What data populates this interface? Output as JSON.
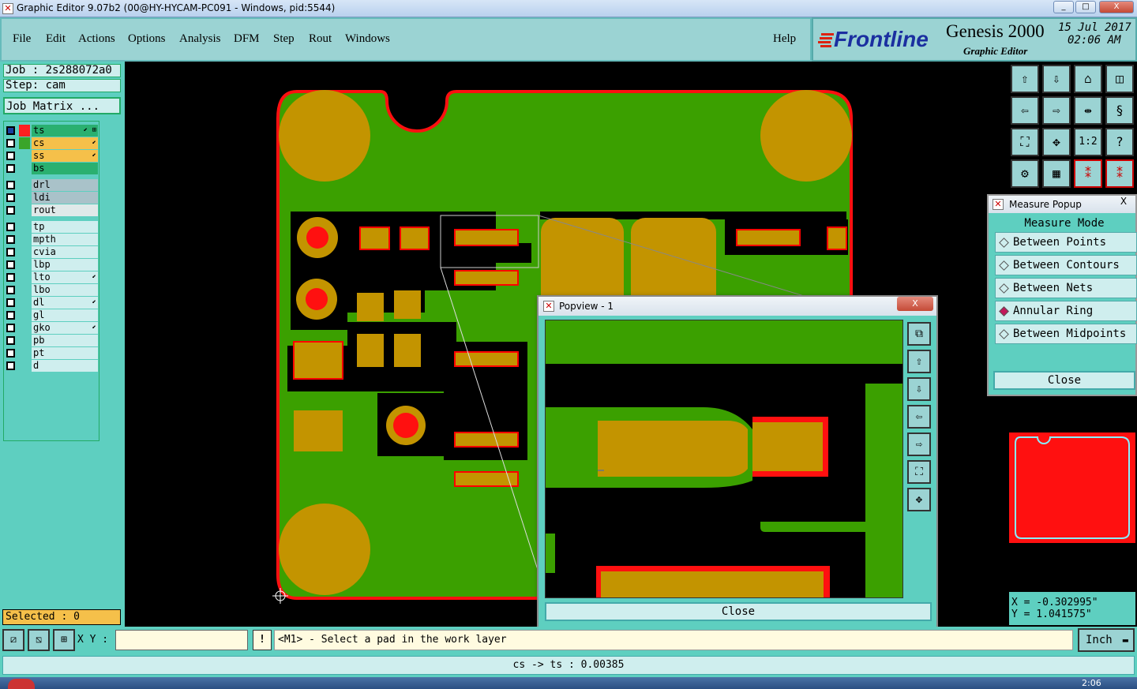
{
  "window": {
    "title": "Graphic Editor 9.07b2 (00@HY-HYCAM-PC091 - Windows, pid:5544)",
    "min": "_",
    "max": "□",
    "close": "X"
  },
  "menu": {
    "items": [
      "File",
      "Edit",
      "Actions",
      "Options",
      "Analysis",
      "DFM",
      "Step",
      "Rout",
      "Windows"
    ],
    "help": "Help"
  },
  "brand": {
    "logo": "Frontline",
    "product": "Genesis 2000",
    "subtitle": "Graphic Editor",
    "date": "15 Jul 2017",
    "time": "02:06 AM"
  },
  "job": {
    "job_label": "Job : 2s288072a0",
    "step_label": "Step: cam",
    "matrix_button": "Job Matrix ...",
    "selected": "Selected : 0"
  },
  "layers": [
    {
      "name": "ts",
      "color": "#2ab070",
      "swatch": "#ff2020",
      "mark": "⬋ ⊞"
    },
    {
      "name": "cs",
      "color": "#f5c04a",
      "swatch": "#3aa52a",
      "mark": "⬋"
    },
    {
      "name": "ss",
      "color": "#f5c04a",
      "swatch": "",
      "mark": "⬋"
    },
    {
      "name": "bs",
      "color": "#2ab070",
      "swatch": "",
      "mark": ""
    },
    {
      "name": "drl",
      "color": "#a9c2c9",
      "swatch": "",
      "mark": ""
    },
    {
      "name": "ldi",
      "color": "#a9c2c9",
      "swatch": "",
      "mark": ""
    },
    {
      "name": "rout",
      "color": "#dfe9e9",
      "swatch": "",
      "mark": ""
    },
    {
      "name": "tp",
      "color": "#cfeeee",
      "swatch": "",
      "mark": ""
    },
    {
      "name": "mpth",
      "color": "#cfeeee",
      "swatch": "",
      "mark": ""
    },
    {
      "name": "cvia",
      "color": "#cfeeee",
      "swatch": "",
      "mark": ""
    },
    {
      "name": "lbp",
      "color": "#cfeeee",
      "swatch": "",
      "mark": ""
    },
    {
      "name": "lto",
      "color": "#cfeeee",
      "swatch": "",
      "mark": "⬋"
    },
    {
      "name": "lbo",
      "color": "#cfeeee",
      "swatch": "",
      "mark": ""
    },
    {
      "name": "dl",
      "color": "#cfeeee",
      "swatch": "",
      "mark": "⬋"
    },
    {
      "name": "gl",
      "color": "#cfeeee",
      "swatch": "",
      "mark": ""
    },
    {
      "name": "gko",
      "color": "#cfeeee",
      "swatch": "",
      "mark": "⬋"
    },
    {
      "name": "pb",
      "color": "#cfeeee",
      "swatch": "",
      "mark": ""
    },
    {
      "name": "pt",
      "color": "#cfeeee",
      "swatch": "",
      "mark": ""
    },
    {
      "name": "d",
      "color": "#cfeeee",
      "swatch": "",
      "mark": ""
    }
  ],
  "measure": {
    "title": "Measure Popup",
    "close_x": "X",
    "mode_label": "Measure Mode",
    "options": [
      "Between Points",
      "Between Contours",
      "Between Nets",
      "Annular Ring",
      "Between Midpoints"
    ],
    "selected": "Annular Ring",
    "close": "Close"
  },
  "popview": {
    "title": "Popview - 1",
    "close_x": "X",
    "close": "Close"
  },
  "coords": {
    "x": "X = -0.302995\"",
    "y": "Y = 1.041575\""
  },
  "bottom": {
    "xy_label": "X Y :",
    "xy_value": "",
    "hint": "<M1> - Select a pad in the work layer",
    "unit": "Inch",
    "alert": "!"
  },
  "status": {
    "text": "cs -> ts : 0.00385"
  },
  "taskbar": {
    "clock": "2:06"
  }
}
